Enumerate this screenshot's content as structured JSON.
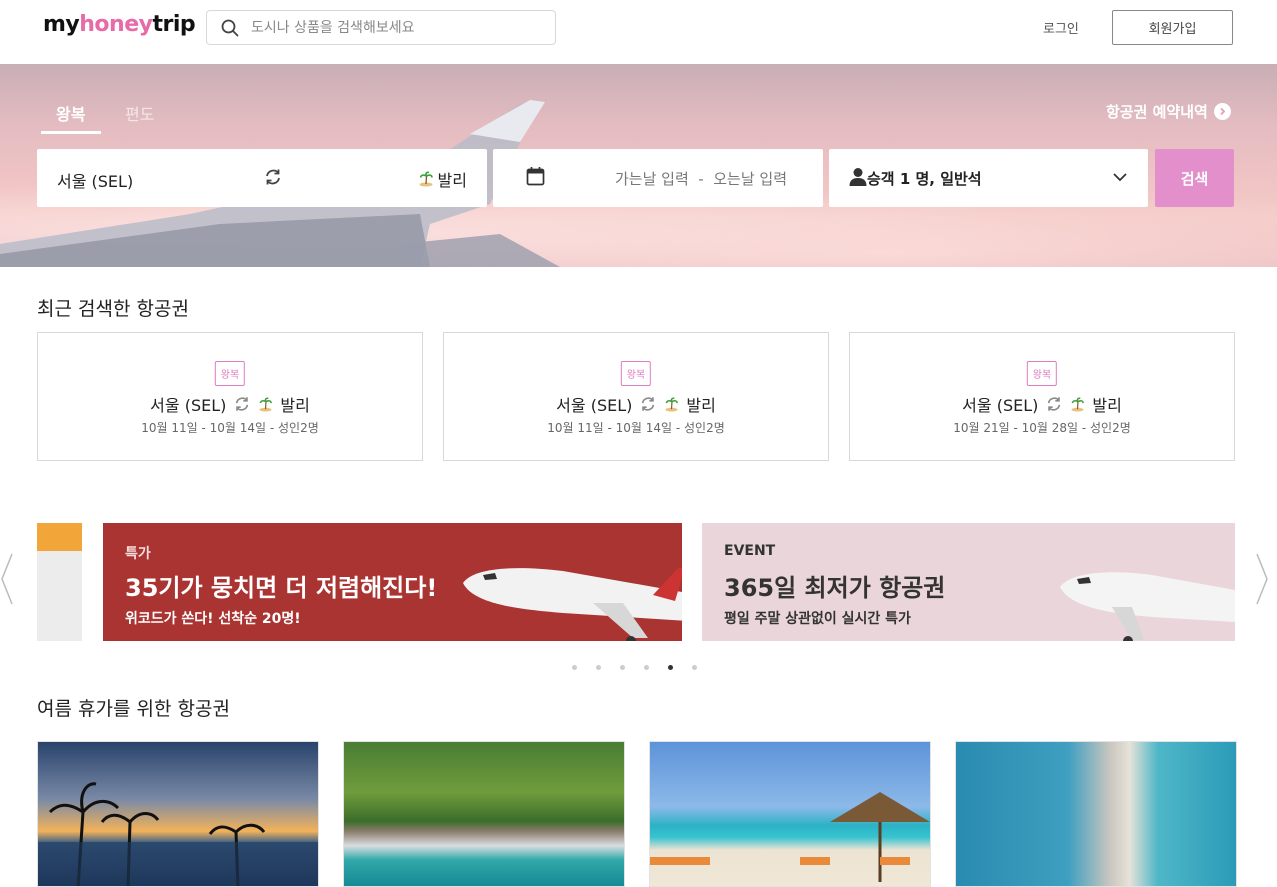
{
  "header": {
    "logo_prefix": "my",
    "logo_honey": "honey",
    "logo_suffix": "trip",
    "search_placeholder": "도시나 상품을 검색해보세요",
    "login_label": "로그인",
    "signup_label": "회원가입"
  },
  "hero": {
    "tabs": [
      {
        "label": "왕복",
        "active": true
      },
      {
        "label": "편도",
        "active": false
      }
    ],
    "history_link": "항공권 예약내역",
    "from": "서울 (SEL)",
    "to": "발리",
    "dates_placeholder": "가는날 입력  -  오는날 입력",
    "passengers": "승객 1 명, 일반석",
    "search_button": "검색"
  },
  "recent": {
    "title": "최근 검색한 항공권",
    "cards": [
      {
        "badge": "왕복",
        "from": "서울 (SEL)",
        "to": "발리",
        "meta": "10월 11일 - 10월 14일 - 성인2명"
      },
      {
        "badge": "왕복",
        "from": "서울 (SEL)",
        "to": "발리",
        "meta": "10월 11일 - 10월 14일 - 성인2명"
      },
      {
        "badge": "왕복",
        "from": "서울 (SEL)",
        "to": "발리",
        "meta": "10월 21일 - 10월 28일 - 성인2명"
      }
    ]
  },
  "banners": [
    {
      "tag": "특가",
      "headline": "35기가 뭉치면 더 저렴해진다!",
      "sub": "위코드가 쏜다! 선착순 20명!",
      "color": "#a93431"
    },
    {
      "tag": "EVENT",
      "headline": "365일 최저가 항공권",
      "sub": "평일 주말 상관없이 실시간 특가",
      "color": "#ead5da"
    }
  ],
  "carousel": {
    "dot_count": 6,
    "active_dot": 5
  },
  "summer": {
    "title": "여름 휴가를 위한 항공권"
  },
  "colors": {
    "accent": "#e38fcb",
    "brand_pink": "#e86aa8"
  }
}
